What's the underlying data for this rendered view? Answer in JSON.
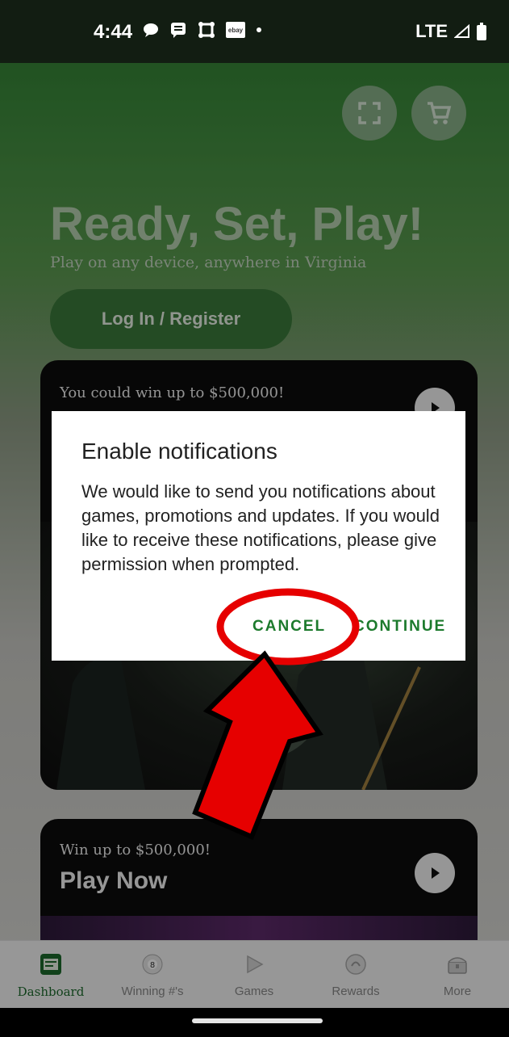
{
  "status_bar": {
    "time": "4:44",
    "network": "LTE",
    "icons": [
      "chat-bubble-icon",
      "message-icon",
      "app-icon",
      "ebay-icon",
      "dot-icon",
      "signal-icon",
      "battery-icon"
    ],
    "ebay_text": "ebay"
  },
  "header": {
    "scan_icon": "scan-icon",
    "cart_icon": "cart-icon"
  },
  "hero": {
    "title": "Ready, Set, Play!",
    "subtitle": "Play on any device, anywhere in Virginia",
    "login_label": "Log In / Register"
  },
  "cards": [
    {
      "eyebrow": "You could win up to $500,000!",
      "title": "",
      "play_icon": "play-icon"
    },
    {
      "eyebrow": "Win up to $500,000!",
      "title": "Play Now",
      "play_icon": "play-icon"
    }
  ],
  "dialog": {
    "title": "Enable notifications",
    "body": "We would like to send you notifications about games, promotions and updates. If you would like to receive these notifications, please give permission when prompted.",
    "cancel_label": "CANCEL",
    "continue_label": "CONTINUE"
  },
  "bottom_nav": {
    "items": [
      {
        "label": "Dashboard",
        "icon": "dashboard-icon",
        "active": true
      },
      {
        "label": "Winning #'s",
        "icon": "lottery-ball-icon",
        "active": false
      },
      {
        "label": "Games",
        "icon": "play-triangle-icon",
        "active": false
      },
      {
        "label": "Rewards",
        "icon": "rewards-icon",
        "active": false
      },
      {
        "label": "More",
        "icon": "treasure-chest-icon",
        "active": false
      }
    ]
  },
  "colors": {
    "accent_green": "#1c7a2c",
    "annotation_red": "#e60000"
  }
}
